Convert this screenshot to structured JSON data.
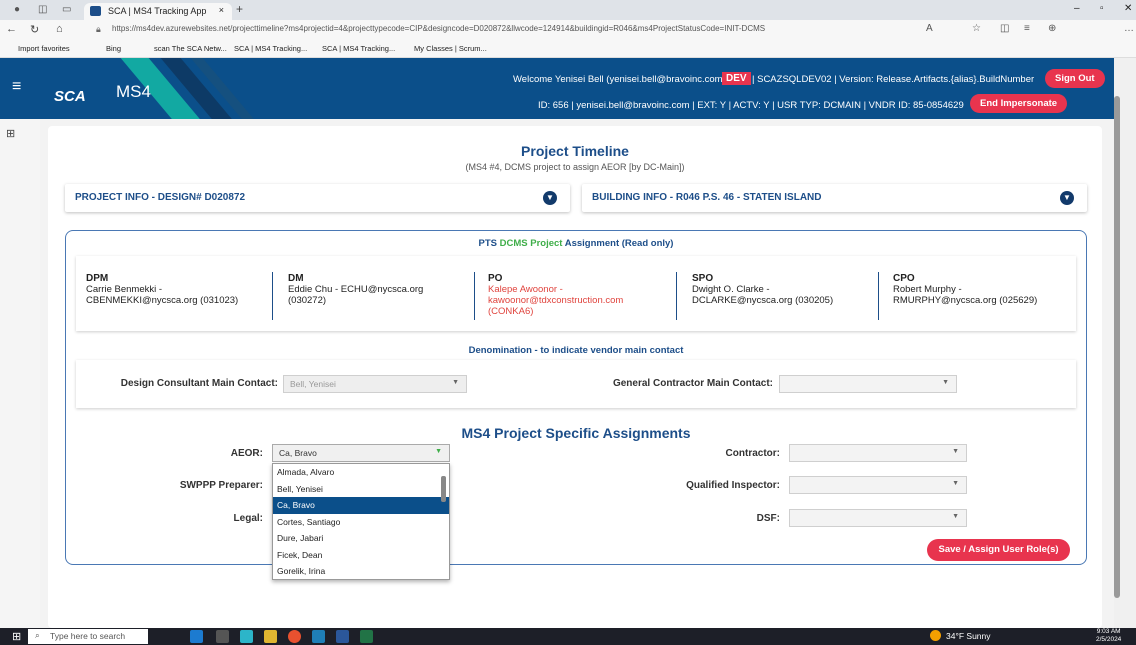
{
  "browser": {
    "tab_title": "SCA | MS4 Tracking App",
    "tab_close": "×",
    "new_tab": "+",
    "url": "https://ms4dev.azurewebsites.net/projecttimeline?ms4projectid=4&projecttypecode=CIP&designcode=D020872&llwcode=124914&buildingid=R046&ms4ProjectStatusCode=INIT-DCMS",
    "favorites": [
      "Import favorites",
      "Bing",
      "scan The SCA Netw...",
      "SCA | MS4 Tracking...",
      "SCA | MS4 Tracking...",
      "My Classes | Scrum..."
    ],
    "window_controls": {
      "min": "–",
      "max": "▫",
      "close": "✕"
    }
  },
  "header": {
    "logo": "SCA",
    "app_name": "MS4",
    "welcome": "Welcome Yenisei Bell (yenisei.bell@bravoinc.com) |",
    "env_badge": "DEV",
    "server_info": "| SCAZSQLDEV02 | Version: Release.Artifacts.{alias}.BuildNumber",
    "sign_out": "Sign Out",
    "id_line": "ID: 656 | yenisei.bell@bravoinc.com | EXT: Y | ACTV: Y | USR TYP: DCMAIN | VNDR ID: 85-0854629",
    "end_impersonate": "End Impersonate"
  },
  "page": {
    "title": "Project Timeline",
    "subtitle": "(MS4 #4, DCMS project to assign AEOR [by DC-Main])",
    "project_info": "PROJECT INFO - DESIGN# D020872",
    "building_info": "BUILDING INFO - R046 P.S. 46 - STATEN ISLAND",
    "pts_title_a": "PTS ",
    "pts_title_b": "DCMS Project",
    "pts_title_c": " Assignment (Read only)",
    "contacts": [
      {
        "role": "DPM",
        "line1": "Carrie Benmekki -",
        "line2": "CBENMEKKI@nycsca.org (031023)",
        "line3": ""
      },
      {
        "role": "DM",
        "line1": "Eddie Chu - ECHU@nycsca.org",
        "line2": "(030272)",
        "line3": ""
      },
      {
        "role": "PO",
        "line1": "Kalepe Awoonor -",
        "line2": "kawoonor@tdxconstruction.com",
        "line3": "(CONKA6)"
      },
      {
        "role": "SPO",
        "line1": "Dwight O. Clarke -",
        "line2": "DCLARKE@nycsca.org (030205)",
        "line3": ""
      },
      {
        "role": "CPO",
        "line1": "Robert Murphy -",
        "line2": "RMURPHY@nycsca.org (025629)",
        "line3": ""
      }
    ],
    "denom_title": "Denomination - to indicate vendor main contact",
    "dc_main_label": "Design Consultant Main Contact:",
    "dc_main_value": "Bell, Yenisei",
    "gc_main_label": "General Contractor Main Contact:",
    "gc_main_value": "",
    "ms4_title": "MS4 Project Specific Assignments",
    "aeor_label": "AEOR:",
    "aeor_value": "Ca, Bravo",
    "swppp_label": "SWPPP Preparer:",
    "legal_label": "Legal:",
    "contractor_label": "Contractor:",
    "qi_label": "Qualified Inspector:",
    "dsf_label": "DSF:",
    "save_button": "Save / Assign User Role(s)",
    "dropdown_options": [
      "Almada, Alvaro",
      "Bell, Yenisei",
      "Ca, Bravo",
      "Cortes, Santiago",
      "Dure, Jabari",
      "Ficek, Dean",
      "Gorelik, Irina"
    ],
    "dropdown_selected": "Ca, Bravo"
  },
  "taskbar": {
    "search": "Type here to search",
    "weather": "34°F Sunny",
    "time": "9:03 AM",
    "date": "2/5/2024"
  },
  "colors": {
    "header": "#0b4f8a",
    "accent_red": "#e8344e",
    "link_blue": "#1d4e89",
    "green": "#3fae49",
    "po_red": "#e0443e"
  }
}
